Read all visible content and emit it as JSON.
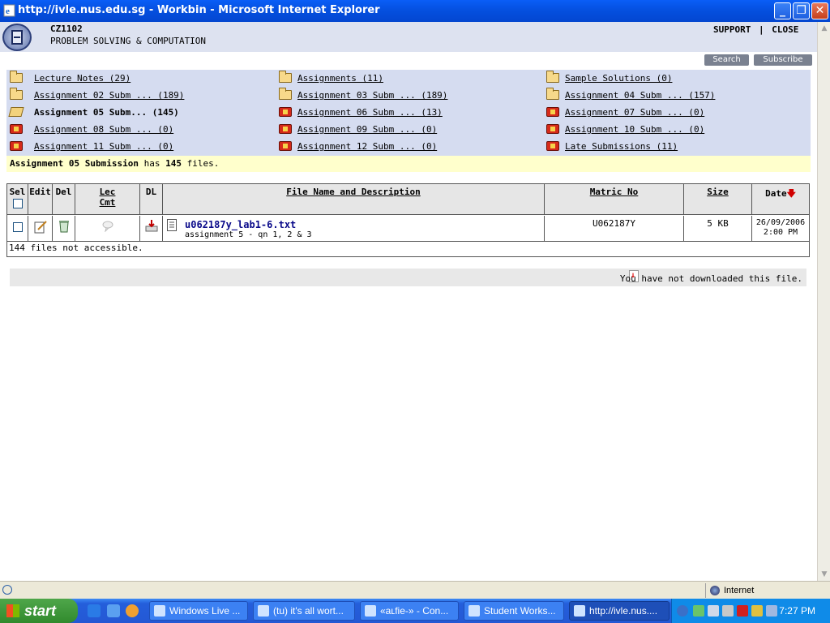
{
  "window": {
    "title": "http://ivle.nus.edu.sg - Workbin - Microsoft Internet Explorer"
  },
  "header": {
    "course_code": "CZ1102",
    "course_name": "PROBLEM SOLVING & COMPUTATION",
    "support_label": "SUPPORT",
    "separator": "|",
    "close_label": "CLOSE",
    "search_label": "Search",
    "subscribe_label": "Subscribe"
  },
  "folders": [
    {
      "label": "Lecture Notes (29)",
      "icon": "folder-icon"
    },
    {
      "label": "Assignments (11)",
      "icon": "folder-icon"
    },
    {
      "label": "Sample Solutions (0)",
      "icon": "folder-icon"
    },
    {
      "label": "Assignment 02 Subm ... (189)",
      "icon": "folder-icon"
    },
    {
      "label": "Assignment 03 Subm ... (189)",
      "icon": "folder-icon"
    },
    {
      "label": "Assignment 04 Subm ... (157)",
      "icon": "folder-icon"
    },
    {
      "label": "Assignment 05 Subm... (145)",
      "icon": "open-folder-icon"
    },
    {
      "label": "Assignment 06 Subm ... (13)",
      "icon": "upload-folder-icon"
    },
    {
      "label": "Assignment 07 Subm ... (0)",
      "icon": "upload-folder-icon"
    },
    {
      "label": "Assignment 08 Subm ... (0)",
      "icon": "upload-folder-icon"
    },
    {
      "label": "Assignment 09 Subm ... (0)",
      "icon": "upload-folder-icon"
    },
    {
      "label": "Assignment 10 Subm ... (0)",
      "icon": "upload-folder-icon"
    },
    {
      "label": "Assignment 11 Subm ... (0)",
      "icon": "upload-folder-icon"
    },
    {
      "label": "Assignment 12 Subm ... (0)",
      "icon": "upload-folder-icon"
    },
    {
      "label": "Late Submissions (11)",
      "icon": "upload-folder-icon"
    }
  ],
  "info": {
    "folder_name": "Assignment 05 Submission",
    "has": " has ",
    "count": "145",
    "files": " files."
  },
  "table": {
    "headers": {
      "sel": "Sel",
      "edit": "Edit",
      "del": "Del",
      "lec": "Lec",
      "cmt": "Cmt",
      "dl": "DL",
      "file": "File Name and Description",
      "matric": "Matric No",
      "size": "Size",
      "date": "Date"
    },
    "rows": [
      {
        "file_name": "u062187y_lab1-6.txt",
        "description": "assignment 5 - qn 1, 2 & 3",
        "matric": "U062187Y",
        "size": "5 KB",
        "date": "26/09/2006",
        "time": "2:00 PM"
      }
    ],
    "footer": "144 files not accessible."
  },
  "legend": {
    "text": "You have not downloaded this file."
  },
  "statusbar": {
    "zone": "Internet"
  },
  "taskbar": {
    "start": "start",
    "tasks": [
      "Windows Live ...",
      "(tu) it's all wort...",
      "«aʟfie-» - Con...",
      "Student Works...",
      "http://ivle.nus...."
    ],
    "clock": "7:27 PM"
  },
  "colors": {
    "title_bar": "#0550e0",
    "folder_panel": "#d5dcf0",
    "info_bar": "#ffffcc",
    "link": "#0a0a8a",
    "taskbar": "#245edb"
  }
}
